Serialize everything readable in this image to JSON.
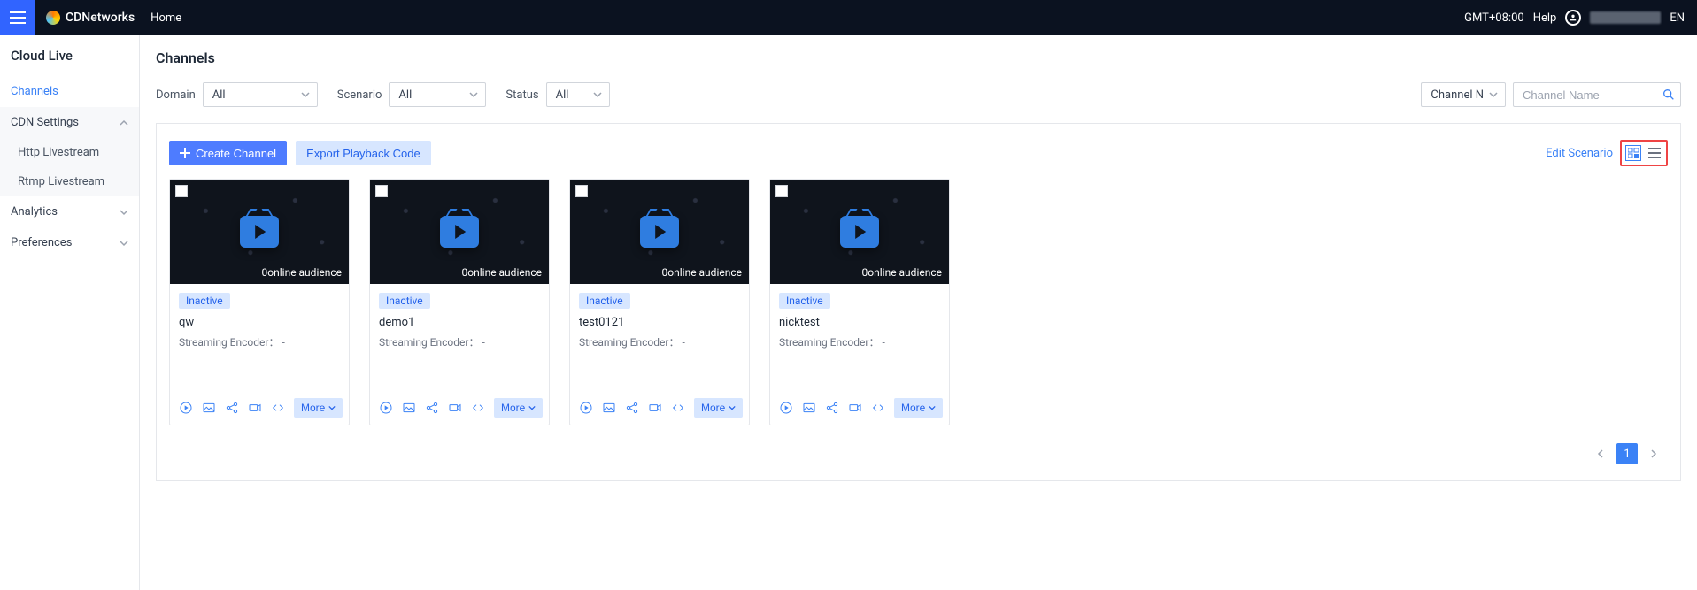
{
  "topbar": {
    "brand": "CDNetworks",
    "home": "Home",
    "timezone": "GMT+08:00",
    "help": "Help",
    "lang": "EN"
  },
  "sidebar": {
    "title": "Cloud Live",
    "channels": "Channels",
    "cdn_settings": "CDN Settings",
    "http_livestream": "Http Livestream",
    "rtmp_livestream": "Rtmp Livestream",
    "analytics": "Analytics",
    "preferences": "Preferences"
  },
  "page": {
    "title": "Channels"
  },
  "filters": {
    "domain_label": "Domain",
    "domain_value": "All",
    "scenario_label": "Scenario",
    "scenario_value": "All",
    "status_label": "Status",
    "status_value": "All",
    "search_by": "Channel N",
    "search_placeholder": "Channel Name"
  },
  "toolbar": {
    "create": "Create Channel",
    "export": "Export Playback Code",
    "edit_scenario": "Edit Scenario"
  },
  "card_labels": {
    "audience": "0online audience",
    "status_inactive": "Inactive",
    "encoder_label": "Streaming Encoder：",
    "encoder_value": "-",
    "more": "More"
  },
  "cards": [
    {
      "name": "qw"
    },
    {
      "name": "demo1"
    },
    {
      "name": "test0121"
    },
    {
      "name": "nicktest"
    }
  ],
  "pager": {
    "page": "1"
  }
}
